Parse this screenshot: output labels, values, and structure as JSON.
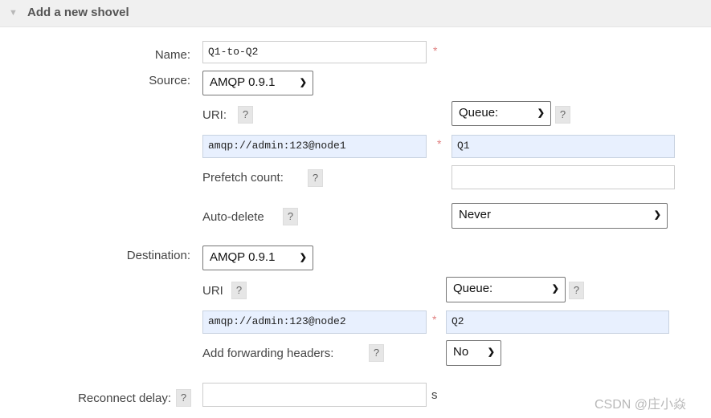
{
  "header": {
    "title": "Add a new shovel"
  },
  "name": {
    "label": "Name:",
    "value": "Q1-to-Q2",
    "required": "*"
  },
  "source": {
    "label": "Source:",
    "protocol": "AMQP 0.9.1",
    "uri_label": "URI:",
    "uri_help": "?",
    "uri_value": "amqp://admin:123@node1",
    "uri_required": "*",
    "type_select": "Queue:",
    "type_help": "?",
    "queue_value": "Q1",
    "prefetch_label": "Prefetch count:",
    "prefetch_help": "?",
    "prefetch_value": "",
    "autodelete_label": "Auto-delete",
    "autodelete_help": "?",
    "autodelete_value": "Never"
  },
  "destination": {
    "label": "Destination:",
    "protocol": "AMQP 0.9.1",
    "uri_label": "URI",
    "uri_help": "?",
    "uri_value": "amqp://admin:123@node2",
    "uri_required": "*",
    "type_select": "Queue:",
    "type_help": "?",
    "queue_value": "Q2",
    "forward_label": "Add forwarding headers:",
    "forward_help": "?",
    "forward_value": "No"
  },
  "reconnect": {
    "label": "Reconnect delay:",
    "help": "?",
    "value": "",
    "unit": "s"
  },
  "watermark": "CSDN @庄小焱",
  "icons": {
    "collapse": "triangle-down-icon",
    "dropdown": "chevron-down-icon"
  }
}
